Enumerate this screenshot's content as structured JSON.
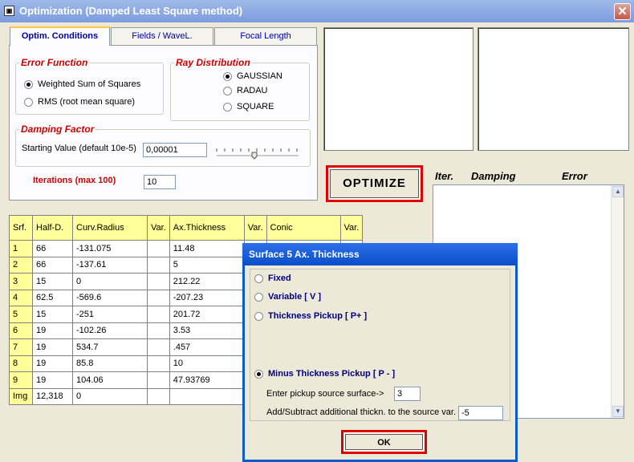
{
  "window": {
    "title": "Optimization  (Damped Least Square method)",
    "close_label": "✕"
  },
  "tabs": [
    {
      "label": "Optim. Conditions"
    },
    {
      "label": "Fields / WaveL."
    },
    {
      "label": "Focal Length"
    }
  ],
  "error_function": {
    "legend": "Error Function",
    "options": [
      {
        "label": "Weighted Sum of Squares",
        "selected": true
      },
      {
        "label": "RMS (root mean square)",
        "selected": false
      }
    ]
  },
  "ray_distribution": {
    "legend": "Ray Distribution",
    "options": [
      {
        "label": "GAUSSIAN",
        "selected": true
      },
      {
        "label": "RADAU",
        "selected": false
      },
      {
        "label": "SQUARE",
        "selected": false
      }
    ]
  },
  "damping": {
    "legend": "Damping Factor",
    "label": "Starting Value (default 10e-5)",
    "value": "0,00001"
  },
  "iterations": {
    "label": "Iterations (max 100)",
    "value": "10"
  },
  "optimize_label": "OPTIMIZE",
  "log_headers": {
    "iter": "Iter.",
    "damping": "Damping",
    "error": "Error"
  },
  "grid": {
    "headers": [
      "Srf.",
      "Half-D.",
      "Curv.Radius",
      "Var.",
      "Ax.Thickness",
      "Var.",
      "Conic",
      "Var."
    ],
    "rows": [
      [
        "1",
        "66",
        "-131.075",
        "",
        "11.48",
        "",
        "",
        ""
      ],
      [
        "2",
        "66",
        "-137.61",
        "",
        "5",
        "",
        "",
        ""
      ],
      [
        "3",
        "15",
        "0",
        "",
        "212.22",
        "",
        "",
        ""
      ],
      [
        "4",
        "62.5",
        "-569.6",
        "",
        "-207.23",
        "",
        "",
        ""
      ],
      [
        "5",
        "15",
        "-251",
        "",
        "201.72",
        "",
        "",
        ""
      ],
      [
        "6",
        "19",
        "-102.26",
        "",
        "3.53",
        "",
        "",
        ""
      ],
      [
        "7",
        "19",
        "534.7",
        "",
        ".457",
        "",
        "",
        ""
      ],
      [
        "8",
        "19",
        "85.8",
        "",
        "10",
        "",
        "",
        ""
      ],
      [
        "9",
        "19",
        "104.06",
        "",
        "47.93769",
        "",
        "",
        ""
      ],
      [
        "Img",
        "12,318",
        "0",
        "",
        "",
        "",
        "",
        ""
      ]
    ]
  },
  "dialog": {
    "title": "Surface 5  Ax. Thickness",
    "options": [
      {
        "label": "Fixed",
        "selected": false
      },
      {
        "label": "Variable  [ V ]",
        "selected": false
      },
      {
        "label": "Thickness Pickup  [ P+ ]",
        "selected": false
      },
      {
        "label": "Minus Thickness Pickup [ P - ]",
        "selected": true
      }
    ],
    "source_label": "Enter pickup source surface->",
    "source_value": "3",
    "add_label": "Add/Subtract additional thickn. to the source var.",
    "add_value": "-5",
    "ok_label": "OK"
  }
}
